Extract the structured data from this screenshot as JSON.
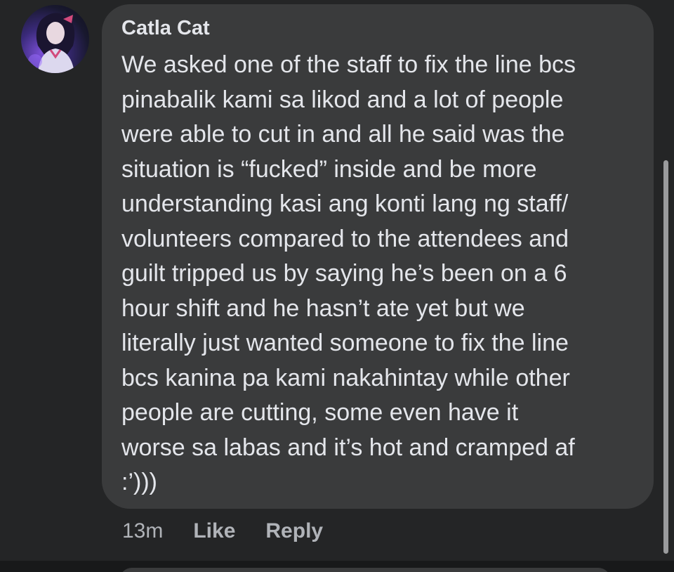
{
  "comment": {
    "author": "Catla Cat",
    "body_lines": [
      "We asked one of the staff to fix the line bcs",
      "pinabalik kami sa likod and a lot of people",
      "were able to cut in and all he said was the",
      "situation is “fucked” inside and be more",
      "understanding kasi ang konti lang ng staff/",
      "volunteers compared to the attendees and",
      "guilt tripped us by saying he’s been on a 6",
      "hour shift and he hasn’t ate yet but we",
      "literally just wanted someone to fix the line",
      "bcs kanina pa kami nakahintay while other",
      "people are cutting, some even have it",
      "worse sa labas and it’s hot and cramped af",
      ":’)))"
    ],
    "timestamp": "13m",
    "like_label": "Like",
    "reply_label": "Reply",
    "avatar_icon": "profile-photo"
  },
  "colors": {
    "background": "#242526",
    "bubble": "#3a3b3c",
    "text_primary": "#e4e6eb",
    "text_secondary": "#b0b3b8"
  }
}
